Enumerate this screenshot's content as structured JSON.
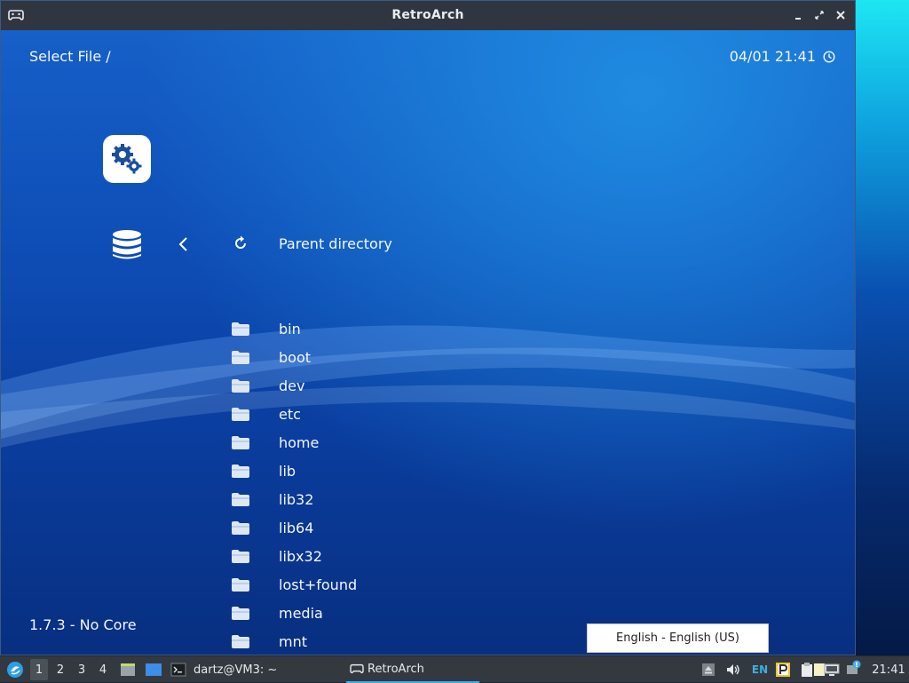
{
  "window": {
    "title": "RetroArch",
    "controls": [
      "minimize",
      "maximize",
      "close"
    ]
  },
  "menu": {
    "header_left": "Select File /",
    "datetime": "04/01 21:41",
    "parent_label": "Parent directory",
    "version": "1.7.3 - No Core",
    "folders": [
      "bin",
      "boot",
      "dev",
      "etc",
      "home",
      "lib",
      "lib32",
      "lib64",
      "libx32",
      "lost+found",
      "media",
      "mnt"
    ]
  },
  "language_popup": {
    "text": "English - English (US)"
  },
  "taskbar": {
    "workspaces": [
      "1",
      "2",
      "3",
      "4"
    ],
    "active_workspace": "1",
    "tasks": [
      {
        "label": "dartz@VM3: ~",
        "icon": "terminal-icon"
      },
      {
        "label": "RetroArch",
        "icon": "gamepad-icon",
        "active": true
      }
    ],
    "tray": {
      "keyboard_layout": "EN",
      "clock": "21:41",
      "icons": [
        "eject-icon",
        "volume-icon",
        "keyboard-layout-indicator",
        "parking-icon",
        "clipboard-icon",
        "notes-icon",
        "network-icon",
        "notification-icon"
      ]
    }
  },
  "colors": {
    "menu_bg_top": "#1660c8",
    "menu_bg_bottom": "#082f80",
    "titlebar": "#2f3640",
    "taskbar": "#33393f",
    "accent": "#3daee9"
  }
}
